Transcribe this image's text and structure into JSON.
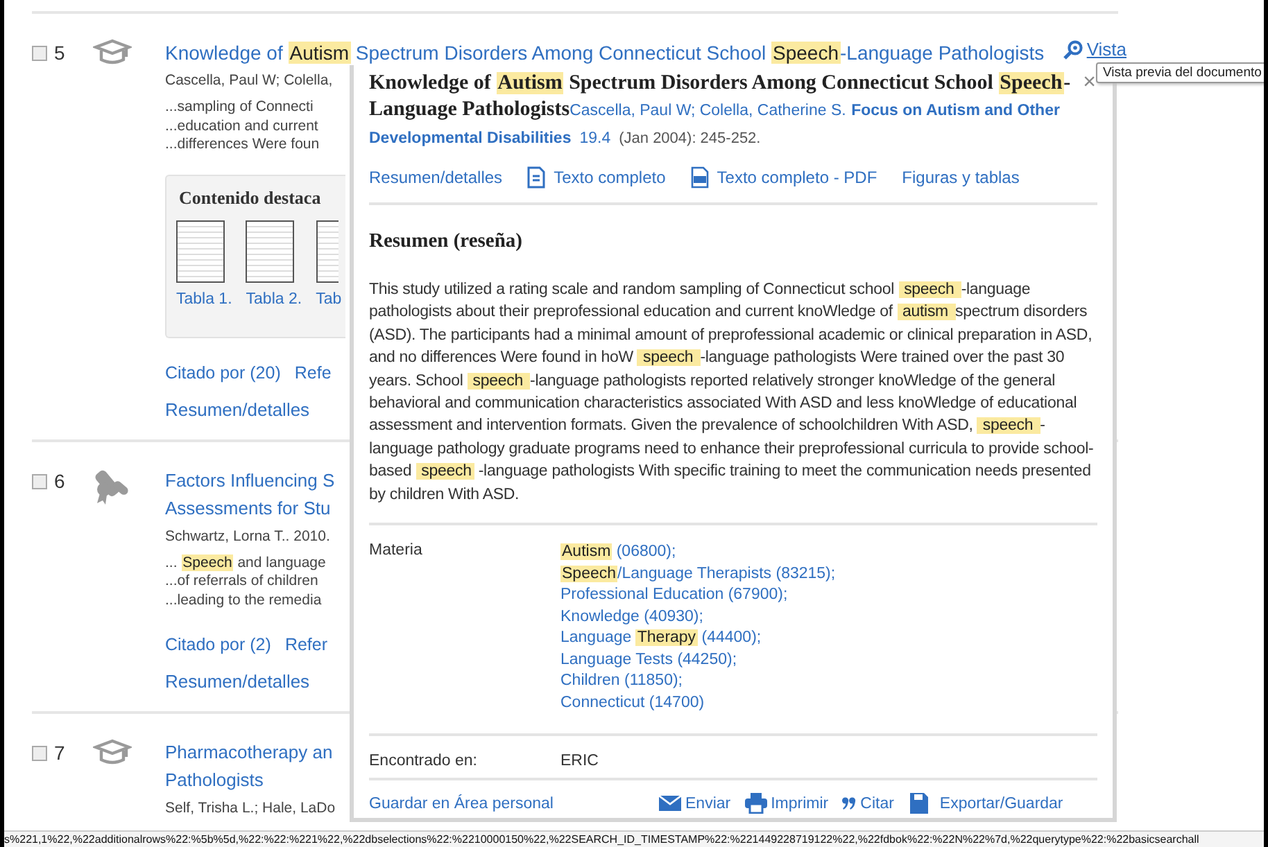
{
  "results": [
    {
      "number": "5",
      "checked": false,
      "kind": "cap",
      "title_lines": [
        [
          {
            "text": "Knowledge of "
          },
          {
            "text": "Autism",
            "highlight": true
          },
          {
            "text": " Spectrum Disorders Among Connecticut School "
          },
          {
            "text": "Speech",
            "highlight": true
          },
          {
            "text": "-Language Pathologists"
          }
        ]
      ],
      "preview_link": "Vista",
      "authors": "Cascella, Paul W; Colella,",
      "snippets": [
        [
          {
            "text": "...sampling of Connecti"
          }
        ],
        [
          {
            "text": "...education and current"
          }
        ],
        [
          {
            "text": "...differences Were foun"
          }
        ]
      ],
      "featured": {
        "heading": "Contenido destaca",
        "thumbnails": [
          "Tabla 1.",
          "Tabla 2.",
          "Tab"
        ]
      },
      "links": [
        "Citado por (20)",
        "Refe"
      ],
      "details_link": "Resumen/detalles"
    },
    {
      "number": "6",
      "checked": false,
      "kind": "scroll",
      "title_lines": [
        [
          {
            "text": "Factors Influencing S"
          }
        ],
        [
          {
            "text": "Assessments for Stu"
          }
        ]
      ],
      "authors": "Schwartz, Lorna T.. 2010.",
      "snippets": [
        [
          {
            "text": "... "
          },
          {
            "text": "Speech",
            "highlight": true
          },
          {
            "text": " and language"
          }
        ],
        [
          {
            "text": "...of referrals of children"
          }
        ],
        [
          {
            "text": "...leading to the remedia"
          }
        ]
      ],
      "links": [
        "Citado por (2)",
        "Refer"
      ],
      "details_link": "Resumen/detalles"
    },
    {
      "number": "7",
      "checked": false,
      "kind": "cap",
      "title_lines": [
        [
          {
            "text": "Pharmacotherapy an"
          }
        ],
        [
          {
            "text": "Pathologists"
          }
        ]
      ],
      "authors": "Self, Trisha L.; Hale, LaDo"
    }
  ],
  "tooltip": "Vista previa del documento",
  "popup": {
    "title": [
      {
        "text": "Knowledge of "
      },
      {
        "text": "Autism",
        "highlight": true
      },
      {
        "text": " Spectrum Disorders Among Connecticut School "
      },
      {
        "text": "Speech",
        "highlight": true
      },
      {
        "text": "-Language Pathologists"
      }
    ],
    "authors": "Cascella, Paul W; Colella, Catherine S.",
    "journal": "Focus on Autism and Other Developmental Disabilities",
    "volume": "19.4",
    "date": "(Jan 2004): 245-252.",
    "close": "×",
    "links": [
      {
        "label": "Resumen/detalles",
        "kind": "plain"
      },
      {
        "label": "Texto completo",
        "kind": "document"
      },
      {
        "label": "Texto completo - PDF",
        "kind": "pdf"
      },
      {
        "label": "Figuras y tablas",
        "kind": "plain"
      }
    ],
    "abstract_heading": "Resumen (reseña)",
    "abstract": [
      {
        "text": "This study utilized a rating scale and random sampling of Connecticut school "
      },
      {
        "text": "speech ",
        "highlight": true
      },
      {
        "text": "-language pathologists about their preprofessional education and current knoWledge of "
      },
      {
        "text": "autism ",
        "highlight": true
      },
      {
        "text": "spectrum disorders (ASD). The participants had a minimal amount of preprofessional academic or clinical preparation in ASD, and no differences Were found in hoW "
      },
      {
        "text": "speech ",
        "highlight": true
      },
      {
        "text": "-language pathologists Were trained over the past 30 years. School "
      },
      {
        "text": "speech ",
        "highlight": true
      },
      {
        "text": "-language pathologists reported relatively stronger knoWledge of the general behavioral and communication characteristics associated With ASD and less knoWledge of educational assessment and intervention formats. Given the prevalence of schoolchildren With ASD, "
      },
      {
        "text": "speech ",
        "highlight": true
      },
      {
        "text": "-language pathology graduate programs need to enhance their preprofessional curricula to provide school-based "
      },
      {
        "text": "speech",
        "highlight": true
      },
      {
        "text": " -language pathologists With specific training to meet the communication needs presented by children With ASD."
      }
    ],
    "subjects_label": "Materia",
    "subjects": [
      [
        {
          "text": "Autism",
          "highlight": true
        },
        {
          "text": " (06800);"
        }
      ],
      [
        {
          "text": "Speech",
          "highlight": true
        },
        {
          "text": "/Language Therapists (83215);"
        }
      ],
      [
        {
          "text": "Professional Education (67900);"
        }
      ],
      [
        {
          "text": "Knowledge (40930);"
        }
      ],
      [
        {
          "text": "Language "
        },
        {
          "text": "Therapy",
          "highlight": true
        },
        {
          "text": " (44400);"
        }
      ],
      [
        {
          "text": "Language Tests (44250);"
        }
      ],
      [
        {
          "text": "Children (11850);"
        }
      ],
      [
        {
          "text": "Connecticut (14700)"
        }
      ]
    ],
    "found_label": "Encontrado en:",
    "found_value": "ERIC",
    "save_link": "Guardar en Área personal",
    "actions": [
      {
        "label": "Enviar",
        "kind": "email"
      },
      {
        "label": "Imprimir",
        "kind": "print"
      },
      {
        "label": "Citar",
        "kind": "cite"
      },
      {
        "label": "Exportar/Guardar",
        "kind": "export"
      }
    ]
  },
  "status_bar": "s%221,1%22,%22additionalrows%22:%5b%5d,%22:%22:%221%22,%22dbselections%22:%2210000150%22,%22SEARCH_ID_TIMESTAMP%22:%221449228719122%22,%22fdbok%22:%22N%22%7d,%22querytype%22:%22basicsearchall"
}
